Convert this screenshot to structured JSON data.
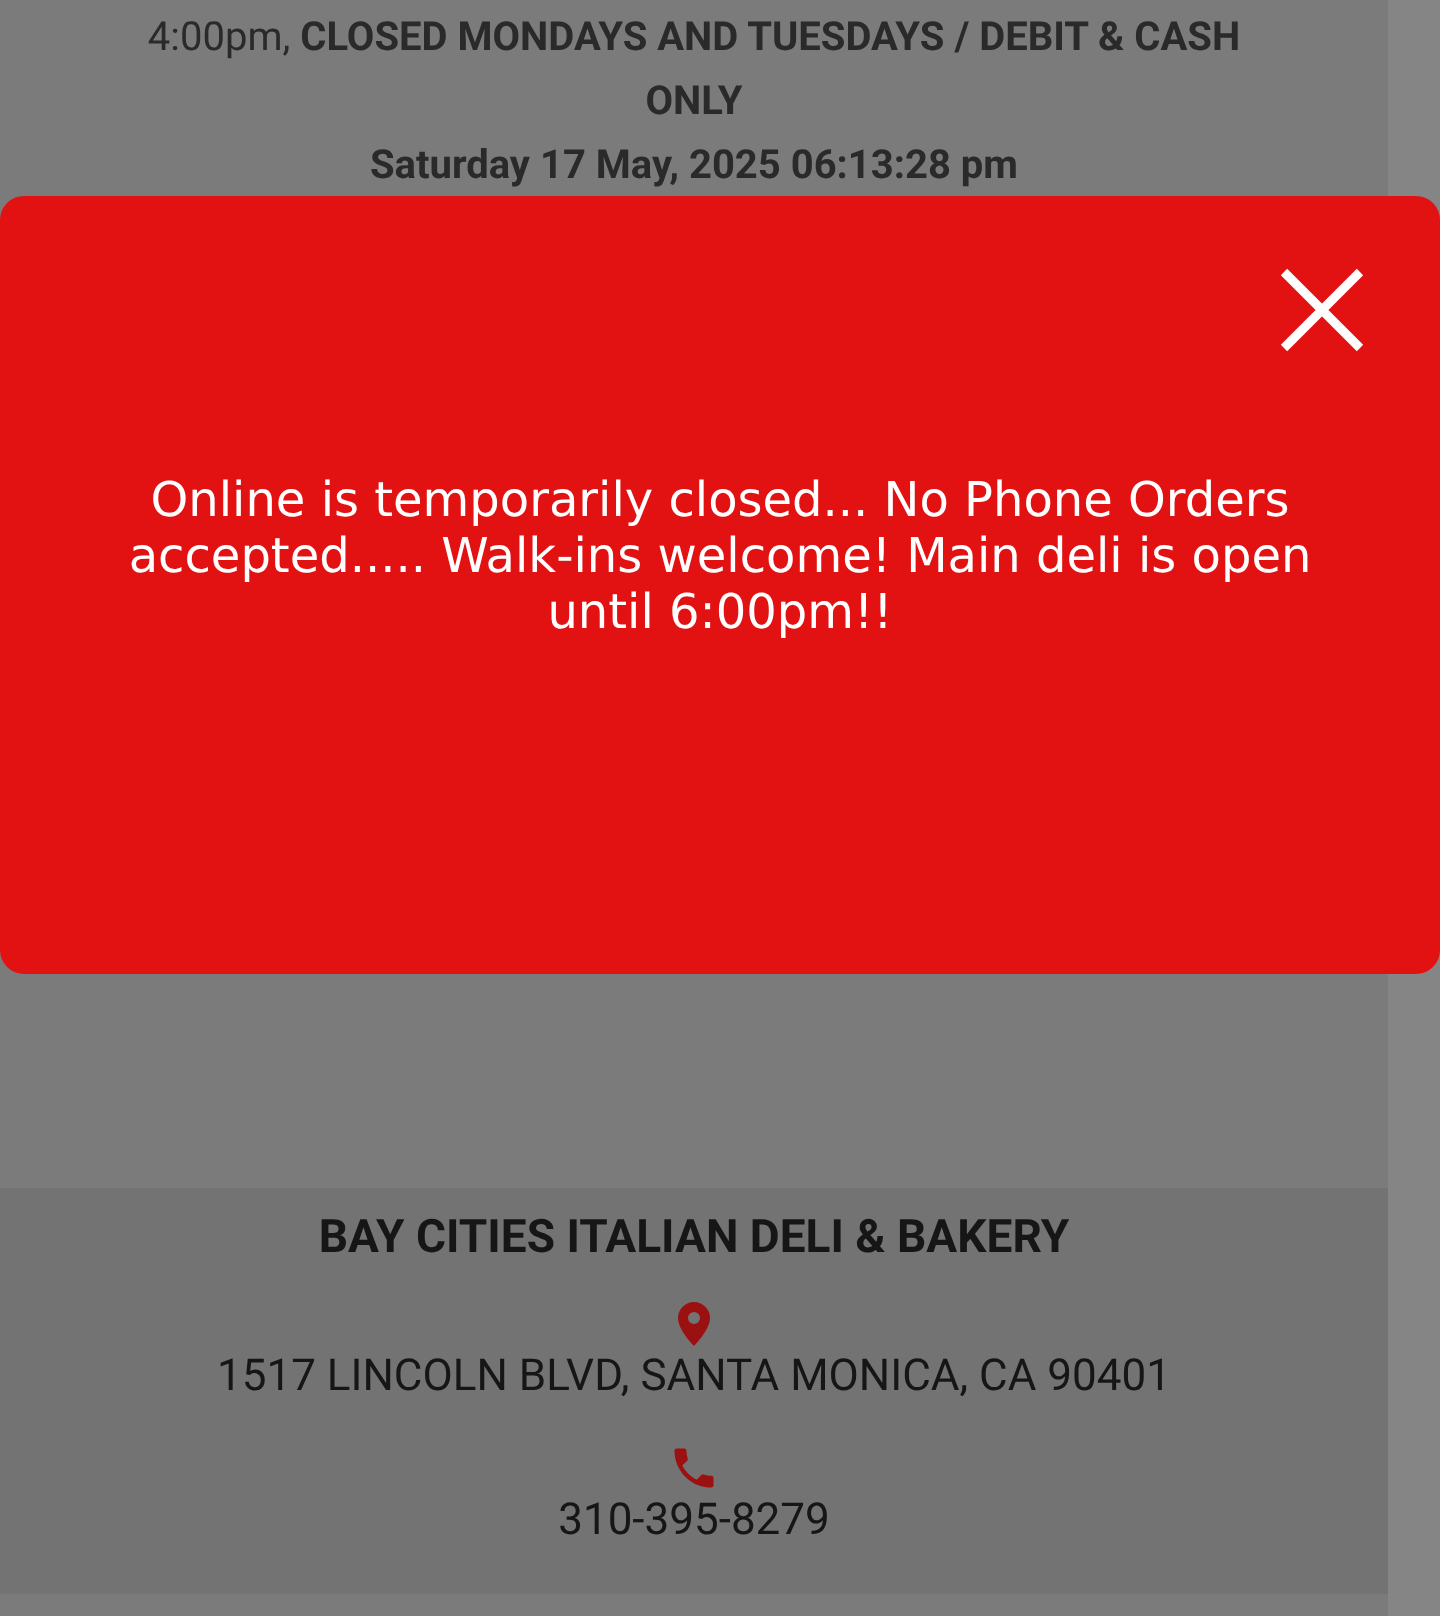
{
  "hours_notice": "4:00pm, **CLOSED MONDAYS AND TUESDAYS / DEBIT & CASH ONLY**",
  "current_datetime": "Saturday 17 May, 2025 06:13:28 pm",
  "modal": {
    "message": "Online is temporarily closed... No Phone Orders accepted..... Walk-ins welcome! Main deli is open until 6:00pm!!"
  },
  "footer": {
    "business_name": "BAY CITIES ITALIAN DELI & BAKERY",
    "address": "1517 LINCOLN BLVD, SANTA MONICA, CA 90401",
    "phone": "310-395-8279"
  }
}
